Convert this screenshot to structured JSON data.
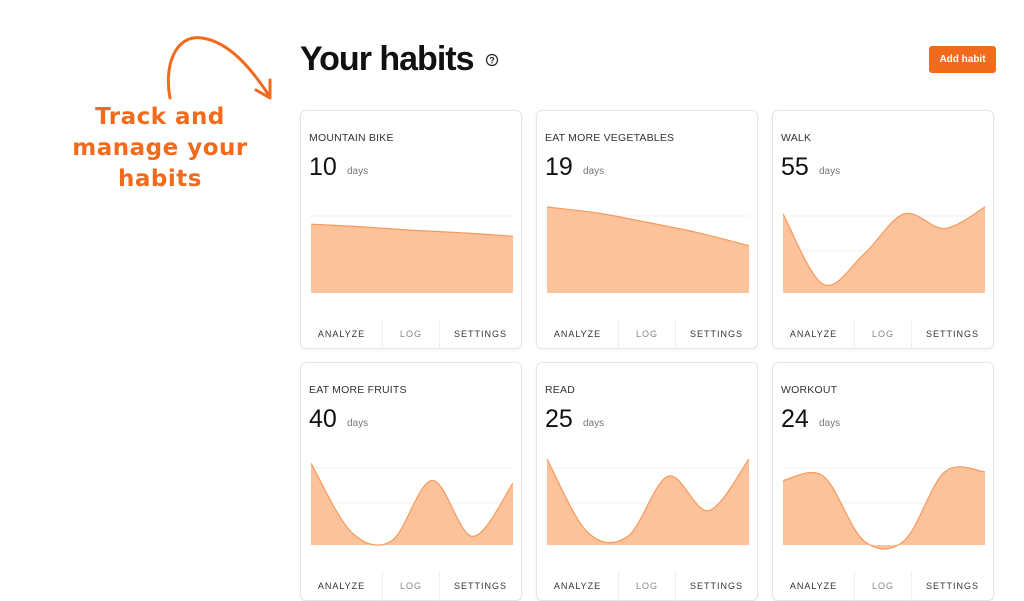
{
  "promo": {
    "lines": [
      "Track and",
      "manage your",
      "habits"
    ]
  },
  "header": {
    "title": "Your habits",
    "add_button": "Add habit"
  },
  "colors": {
    "accent": "#f26a1b",
    "chart_fill": "#fbc29b",
    "chart_stroke": "#f79a5e"
  },
  "icons": {
    "help": "help-circle-icon",
    "arrow": "curved-arrow-icon"
  },
  "actions": {
    "analyze": "ANALYZE",
    "log": "LOG",
    "settings": "SETTINGS"
  },
  "habits": [
    {
      "name": "MOUNTAIN BIKE",
      "count": "10",
      "unit": "days",
      "trend": [
        0.8,
        0.77,
        0.73,
        0.7,
        0.66
      ]
    },
    {
      "name": "EAT MORE VEGETABLES",
      "count": "19",
      "unit": "days",
      "trend": [
        1.0,
        0.93,
        0.82,
        0.7,
        0.55
      ]
    },
    {
      "name": "WALK",
      "count": "55",
      "unit": "days",
      "trend": [
        0.92,
        0.1,
        0.45,
        0.92,
        0.75,
        1.0
      ]
    },
    {
      "name": "EAT MORE FRUITS",
      "count": "40",
      "unit": "days",
      "trend": [
        0.95,
        0.15,
        0.05,
        0.75,
        0.1,
        0.72
      ]
    },
    {
      "name": "READ",
      "count": "25",
      "unit": "days",
      "trend": [
        1.0,
        0.15,
        0.1,
        0.8,
        0.4,
        1.0
      ]
    },
    {
      "name": "WORKOUT",
      "count": "24",
      "unit": "days",
      "trend": [
        0.75,
        0.8,
        0.05,
        0.05,
        0.85,
        0.85
      ]
    }
  ]
}
